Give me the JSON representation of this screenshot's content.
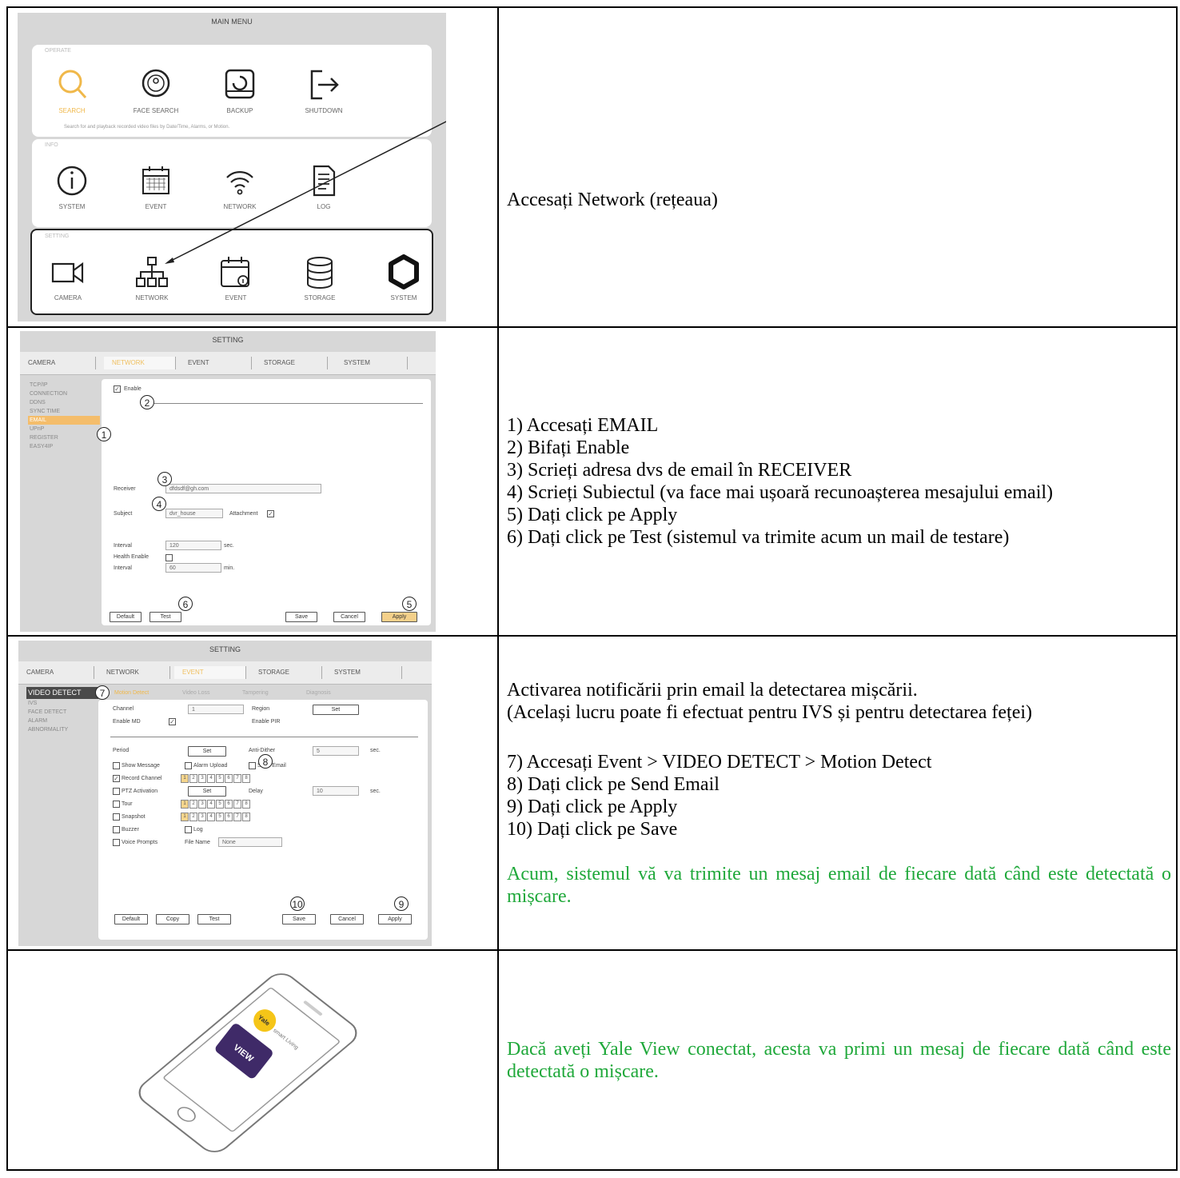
{
  "row1": {
    "screenshot": {
      "title": "MAIN MENU",
      "operate_label": "OPERATE",
      "operate": [
        "SEARCH",
        "FACE SEARCH",
        "BACKUP",
        "SHUTDOWN"
      ],
      "hint": "Search for and playback recorded video files by Date/Time, Alarms, or Motion.",
      "info_label": "INFO",
      "info": [
        "SYSTEM",
        "EVENT",
        "NETWORK",
        "LOG"
      ],
      "setting_label": "SETTING",
      "setting": [
        "CAMERA",
        "NETWORK",
        "EVENT",
        "STORAGE",
        "SYSTEM"
      ]
    },
    "text": "Accesați Network (rețeaua)"
  },
  "row2": {
    "screenshot": {
      "title": "SETTING",
      "tabs": [
        "CAMERA",
        "NETWORK",
        "EVENT",
        "STORAGE",
        "SYSTEM"
      ],
      "sidenav": [
        "TCP/IP",
        "CONNECTION",
        "DDNS",
        "SYNC TIME",
        "EMAIL",
        "UPnP",
        "REGISTER",
        "EASY4IP"
      ],
      "enable": "Enable",
      "receiver_label": "Receiver",
      "receiver_value": "dfdsdf@gh.com",
      "subject_label": "Subject",
      "subject_value": "dvr_house",
      "attachment": "Attachment",
      "interval_label": "Interval",
      "interval_value": "120",
      "sec": "sec.",
      "health": "Health Enable",
      "interval2_label": "Interval",
      "interval2_value": "60",
      "min": "min.",
      "btn_default": "Default",
      "btn_test": "Test",
      "btn_save": "Save",
      "btn_cancel": "Cancel",
      "btn_apply": "Apply",
      "markers": [
        "1",
        "2",
        "3",
        "4",
        "5",
        "6"
      ]
    },
    "lines": [
      "1) Accesați EMAIL",
      "2) Bifați Enable",
      "3) Scrieți adresa dvs de email în RECEIVER",
      "4) Scrieți Subiectul (va face mai ușoară recunoașterea mesajului email)",
      "5) Dați click pe Apply",
      "6) Dați click pe Test (sistemul va trimite acum un mail de testare)"
    ]
  },
  "row3": {
    "screenshot": {
      "title": "SETTING",
      "tabs": [
        "CAMERA",
        "NETWORK",
        "EVENT",
        "STORAGE",
        "SYSTEM"
      ],
      "sidenav": [
        "VIDEO DETECT",
        "IVS",
        "FACE DETECT",
        "ALARM",
        "ABNORMALITY"
      ],
      "subtabs": [
        "Motion Detect",
        "Video Loss",
        "Tampering",
        "Diagnosis"
      ],
      "channel_label": "Channel",
      "channel_value": "1",
      "region": "Region",
      "set": "Set",
      "enable_md": "Enable MD",
      "enable_pir": "Enable PIR",
      "period": "Period",
      "anti_dither": "Anti-Dither",
      "anti_value": "5",
      "sec": "sec.",
      "show_message": "Show Message",
      "alarm_upload": "Alarm Upload",
      "send_email": "Send Email",
      "record_channel": "Record Channel",
      "ptz": "PTZ Activation",
      "delay": "Delay",
      "delay_value": "10",
      "tour": "Tour",
      "snapshot": "Snapshot",
      "buzzer": "Buzzer",
      "log": "Log",
      "voice": "Voice Prompts",
      "file_name": "File Name",
      "none": "None",
      "channels": [
        "1",
        "2",
        "3",
        "4",
        "5",
        "6",
        "7",
        "8"
      ],
      "btn_default": "Default",
      "btn_copy": "Copy",
      "btn_test": "Test",
      "btn_save": "Save",
      "btn_cancel": "Cancel",
      "btn_apply": "Apply",
      "markers": [
        "7",
        "8",
        "9",
        "10"
      ]
    },
    "intro1": "Activarea notificării prin email la detectarea mișcării.",
    "intro2": "(Același lucru poate fi efectuat pentru IVS și pentru detectarea feței)",
    "lines": [
      "7) Accesați Event > VIDEO DETECT > Motion Detect",
      "8) Dați click pe Send Email",
      "9) Dați click pe Apply",
      "10) Dați click pe Save"
    ],
    "green_text": "Acum, sistemul vă va trimite un mesaj email de fiecare dată când este detectată o mișcare."
  },
  "row4": {
    "phone": {
      "logo_small": "Yale",
      "logo_sub": "smart Living",
      "app": "VIEW"
    },
    "green_text": "Dacă aveți Yale View conectat, acesta va primi un mesaj de fiecare dată când este detectată o mișcare."
  },
  "colors": {
    "green": "#1fa83a",
    "accent_yellow": "#f0b84a",
    "purple": "#3f2a68"
  }
}
